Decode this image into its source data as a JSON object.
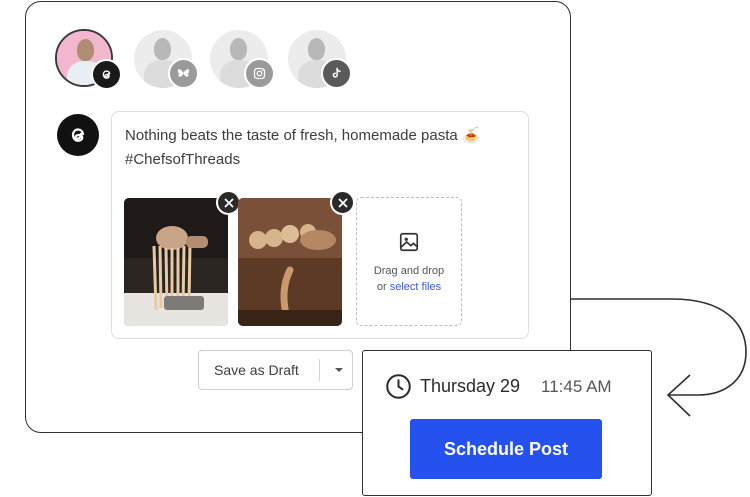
{
  "profiles": [
    {
      "name": "threads",
      "active": true
    },
    {
      "name": "bluesky",
      "active": false
    },
    {
      "name": "instagram",
      "active": false
    },
    {
      "name": "tiktok",
      "active": false
    }
  ],
  "composer": {
    "channel_icon": "threads-icon",
    "text_line1": "Nothing beats the taste of fresh, homemade pasta 🍝",
    "text_line2": "#ChefsofThreads",
    "dropzone_line1": "Drag and drop",
    "dropzone_or": "or ",
    "dropzone_link": "select files"
  },
  "actions": {
    "save_draft_label": "Save as Draft"
  },
  "schedule": {
    "day": "Thursday 29",
    "time": "11:45 AM",
    "button_label": "Schedule Post"
  },
  "colors": {
    "accent": "#2551ee",
    "link": "#3a5bd9",
    "badge_active": "#1a1a1a",
    "badge_inactive": "#9a9a9a"
  }
}
